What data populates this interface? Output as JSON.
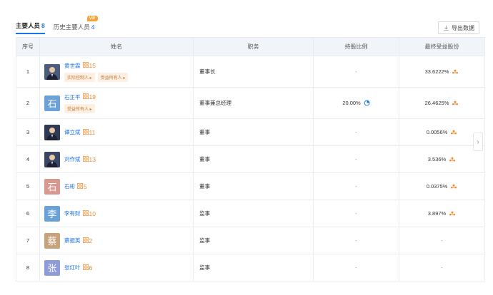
{
  "tabs": [
    {
      "label": "主要人员",
      "count": "8",
      "active": true
    },
    {
      "label": "历史主要人员",
      "count": "4",
      "active": false,
      "badge": "VIP"
    }
  ],
  "export_label": "导出数据",
  "columns": [
    "序号",
    "姓名",
    "职务",
    "持股比例",
    "最终受益股份"
  ],
  "rows": [
    {
      "idx": "1",
      "avatar_char": "",
      "avatar_color": "#4a5d7e",
      "photo": true,
      "name": "黄世霖",
      "count": "15",
      "tags": [
        "实际控制人 ▸",
        "受益所有人 ▸"
      ],
      "position": "董事长",
      "ratio": "-",
      "final": "33.6222%",
      "ratio_icon": false,
      "final_icon": true
    },
    {
      "idx": "2",
      "avatar_char": "石",
      "avatar_color": "#6aa1d6",
      "photo": false,
      "name": "石正平",
      "count": "19",
      "tags": [
        "受益所有人 ▸"
      ],
      "position": "董事兼总经理",
      "ratio": "20.00%",
      "final": "26.4625%",
      "ratio_icon": true,
      "final_icon": true
    },
    {
      "idx": "3",
      "avatar_char": "",
      "avatar_color": "#2f3b55",
      "photo": true,
      "name": "谭立斌",
      "count": "11",
      "tags": [],
      "position": "董事",
      "ratio": "-",
      "final": "0.0056%",
      "ratio_icon": false,
      "final_icon": true
    },
    {
      "idx": "4",
      "avatar_char": "",
      "avatar_color": "#3a4666",
      "photo": true,
      "name": "刘作斌",
      "count": "13",
      "tags": [],
      "position": "董事",
      "ratio": "-",
      "final": "3.536%",
      "ratio_icon": false,
      "final_icon": true
    },
    {
      "idx": "5",
      "avatar_char": "石",
      "avatar_color": "#d8978f",
      "photo": false,
      "name": "石彬",
      "count": "5",
      "tags": [],
      "position": "董事",
      "ratio": "-",
      "final": "0.0375%",
      "ratio_icon": false,
      "final_icon": true
    },
    {
      "idx": "6",
      "avatar_char": "李",
      "avatar_color": "#6aa1d6",
      "photo": false,
      "name": "李有财",
      "count": "10",
      "tags": [],
      "position": "监事",
      "ratio": "-",
      "final": "3.897%",
      "ratio_icon": false,
      "final_icon": true
    },
    {
      "idx": "7",
      "avatar_char": "蔡",
      "avatar_color": "#c8a27a",
      "photo": false,
      "name": "蔡振英",
      "count": "2",
      "tags": [],
      "position": "监事",
      "ratio": "-",
      "final": "-",
      "ratio_icon": false,
      "final_icon": false
    },
    {
      "idx": "8",
      "avatar_char": "张",
      "avatar_color": "#8f9ad8",
      "photo": false,
      "name": "张红叶",
      "count": "6",
      "tags": [],
      "position": "监事",
      "ratio": "-",
      "final": "-",
      "ratio_icon": false,
      "final_icon": false
    }
  ],
  "colors": {
    "accent": "#1a73e8",
    "orange": "#f08a2c",
    "header_bg": "#f1f5fa",
    "tag_bg": "#fdf0e3"
  },
  "icons": {
    "export": "download-icon",
    "ratio": "pie-chart-icon",
    "final": "people-icon",
    "count": "person-count-icon",
    "side": "chevron-right-icon"
  }
}
